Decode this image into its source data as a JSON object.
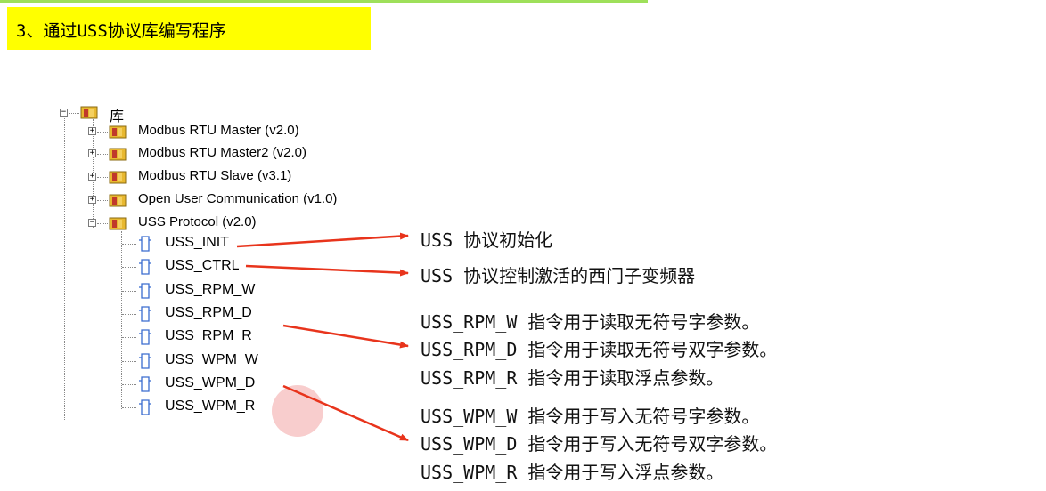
{
  "heading": {
    "text": "3、通过USS协议库编写程序"
  },
  "tree": {
    "root": {
      "label": "库",
      "expander": "−"
    },
    "libraries": [
      {
        "label": "Modbus RTU Master (v2.0)",
        "expander": "+"
      },
      {
        "label": "Modbus RTU Master2 (v2.0)",
        "expander": "+"
      },
      {
        "label": "Modbus RTU Slave (v3.1)",
        "expander": "+"
      },
      {
        "label": "Open User Communication (v1.0)",
        "expander": "+"
      },
      {
        "label": "USS Protocol (v2.0)",
        "expander": "−"
      }
    ],
    "uss_blocks": [
      "USS_INIT",
      "USS_CTRL",
      "USS_RPM_W",
      "USS_RPM_D",
      "USS_RPM_R",
      "USS_WPM_W",
      "USS_WPM_D",
      "USS_WPM_R"
    ]
  },
  "descriptions": {
    "init": "USS 协议初始化",
    "ctrl": "USS 协议控制激活的西门子变频器",
    "rpm_w": "USS_RPM_W 指令用于读取无符号字参数。",
    "rpm_d": "USS_RPM_D 指令用于读取无符号双字参数。",
    "rpm_r": "USS_RPM_R 指令用于读取浮点参数。",
    "wpm_w": "USS_WPM_W 指令用于写入无符号字参数。",
    "wpm_d": "USS_WPM_D 指令用于写入无符号双字参数。",
    "wpm_r": "USS_WPM_R 指令用于写入浮点参数。"
  },
  "colors": {
    "heading_bg": "#ffff00",
    "arrow": "#e8341c",
    "highlight_circle": "#f7c4c4",
    "folder": "#e8b830"
  }
}
